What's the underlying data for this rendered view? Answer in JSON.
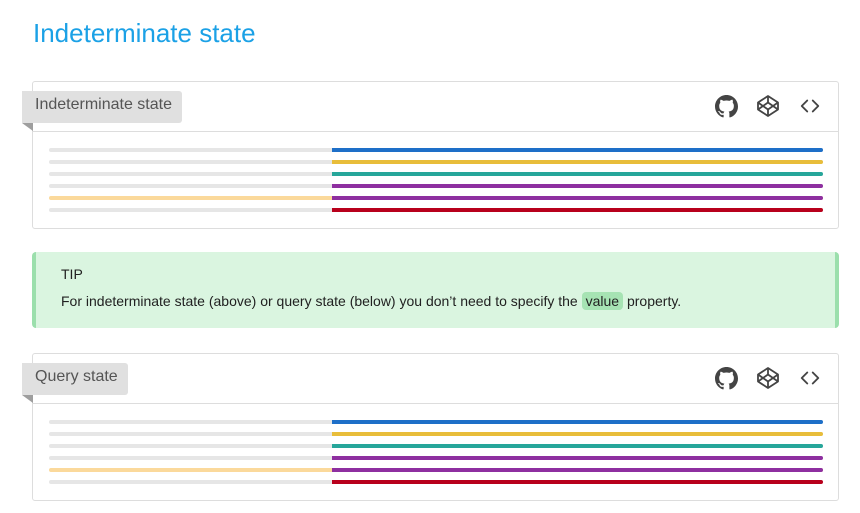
{
  "page": {
    "title": "Indeterminate state"
  },
  "cards": [
    {
      "label": "Indeterminate state",
      "bars": [
        {
          "color": "#1e6fc8",
          "track": "#e6e6e6"
        },
        {
          "color": "#e8bd3a",
          "track": "#e6e6e6"
        },
        {
          "color": "#26a69a",
          "track": "#e6e6e6"
        },
        {
          "color": "#8e2fa0",
          "track": "#e6e6e6"
        },
        {
          "color": "#8e2fa0",
          "track": "#fbd99b"
        },
        {
          "color": "#b8001c",
          "track": "#e6e6e6"
        }
      ]
    },
    {
      "label": "Query state",
      "bars": [
        {
          "color": "#1e6fc8",
          "track": "#e6e6e6"
        },
        {
          "color": "#e8bd3a",
          "track": "#e6e6e6"
        },
        {
          "color": "#26a69a",
          "track": "#e6e6e6"
        },
        {
          "color": "#8e2fa0",
          "track": "#e6e6e6"
        },
        {
          "color": "#8e2fa0",
          "track": "#fbd99b"
        },
        {
          "color": "#b8001c",
          "track": "#e6e6e6"
        }
      ]
    }
  ],
  "tip": {
    "title": "TIP",
    "text_before": "For indeterminate state (above) or query state (below) you don’t need to specify the ",
    "code": "value",
    "text_after": " property."
  },
  "icons": {
    "github": "github-icon",
    "codepen": "codepen-icon",
    "code": "code-icon"
  }
}
